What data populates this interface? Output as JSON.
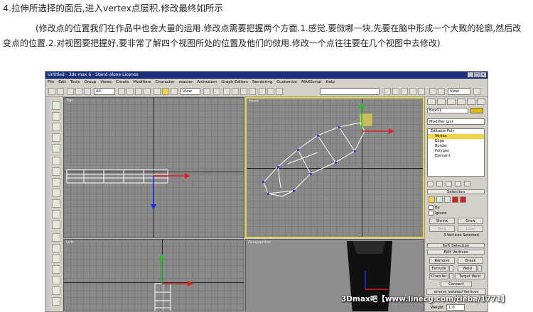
{
  "heading": "4.拉伸所选择的面后,进入vertex点层积.修改最终如所示",
  "paragraph": "(修改点的位置我们在作品中也会大量的运用.修改点需要把握两个方面.1.感觉.要傚哪一块,先要在脑中形成一个大致的轮廓,然后改变点的位置.2.对视图要把握好,要非常了解四个视图所处的位置及他们的傚用.修改一个点往往要在几个视图中去修改)",
  "app": {
    "title": "Untitled - 3ds max 6 - Stand-alone License",
    "window_buttons": [
      "_",
      "□",
      "×"
    ],
    "menu": [
      "File",
      "Edit",
      "Tools",
      "Group",
      "Views",
      "Create",
      "Modifiers",
      "Character",
      "reactor",
      "Animation",
      "Graph Editors",
      "Rendering",
      "Customize",
      "MAXScript",
      "Help"
    ],
    "toolbar": {
      "selection_filter": "All",
      "ref_coord": "View",
      "named_selection": "",
      "right_view": "View"
    },
    "viewports": {
      "top": "Top",
      "front": "Front",
      "left": "Left",
      "perspective": "Perspective"
    },
    "command_panel": {
      "object_name": "Box01",
      "modifier_list": "Modifier List",
      "stack": {
        "base": "Editable Poly",
        "items": [
          "Vertex",
          "Edge",
          "Border",
          "Polygon",
          "Element"
        ],
        "selected": "Vertex"
      },
      "selection": {
        "header": "Selection",
        "by_vertex": "By",
        "ignore_backfacing": "Ignore",
        "shrink": "Shrink",
        "grow": "Grow",
        "ring": "Ring",
        "loop": "Loop",
        "status": "3 Vertices Selected"
      },
      "soft_selection": "Soft Selection",
      "edit_vertices": {
        "header": "Edit Vertices",
        "remove": "Remove",
        "break": "Break",
        "extrude": "Extrude",
        "weld": "Weld",
        "chamfer": "Chamfer",
        "target_weld": "Target Weld",
        "connect": "Connect",
        "remove_isolated": "emove Isolated Vertices",
        "weight_label": "Weight",
        "weight_value": "1.0"
      }
    }
  },
  "watermark": "3Dmax吧【www.linecg.com/tieba/1771】",
  "colors": {
    "titlebar": "#1c2f7a",
    "active_viewport_border": "#e8d640",
    "selected_highlight": "#f5d34a",
    "mesh_edges": "#ffffff",
    "vertices": "#3a3ad8",
    "x_axis": "#e02020",
    "y_axis": "#20c020",
    "z_axis": "#2030e0"
  }
}
